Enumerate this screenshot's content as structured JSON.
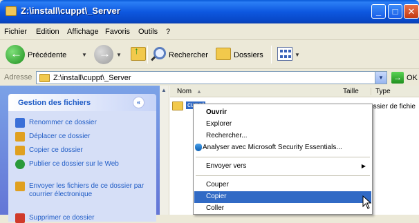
{
  "window": {
    "title": "Z:\\install\\cuppt\\_Server"
  },
  "menubar": {
    "items": [
      "Fichier",
      "Edition",
      "Affichage",
      "Favoris",
      "Outils",
      "?"
    ]
  },
  "toolbar": {
    "back_label": "Précédente",
    "search_label": "Rechercher",
    "folders_label": "Dossiers"
  },
  "address": {
    "label": "Adresse",
    "value": "Z:\\install\\cuppt\\_Server",
    "go_label": "OK"
  },
  "taskpane": {
    "header": "Gestion des fichiers",
    "collapse_glyph": "«",
    "items": [
      {
        "label": "Renommer ce dossier",
        "icon": "rename-icon",
        "color": "#3a6fd8"
      },
      {
        "label": "Déplacer ce dossier",
        "icon": "move-icon",
        "color": "#e0a020"
      },
      {
        "label": "Copier ce dossier",
        "icon": "copy-icon",
        "color": "#e0a020"
      },
      {
        "label": "Publier ce dossier sur le Web",
        "icon": "publish-web-icon",
        "color": "#2a9a3a"
      },
      {
        "label": "Envoyer les fichiers de ce dossier par courrier électronique",
        "icon": "email-icon",
        "color": "#e0a020"
      },
      {
        "label": "Supprimer ce dossier",
        "icon": "delete-icon",
        "color": "#d03a2a"
      }
    ]
  },
  "filelist": {
    "columns": {
      "name": "Nom",
      "size": "Taille",
      "type": "Type"
    },
    "rows": [
      {
        "name": "cuppt",
        "type": "Dossier de fichie"
      }
    ]
  },
  "context_menu": {
    "items": [
      {
        "label": "Ouvrir",
        "bold": true
      },
      {
        "label": "Explorer"
      },
      {
        "label": "Rechercher..."
      },
      {
        "label": "Analyser avec Microsoft Security Essentials...",
        "icon": "security-essentials-icon"
      },
      {
        "label": "Envoyer vers",
        "submenu": true
      },
      {
        "label": "Couper"
      },
      {
        "label": "Copier",
        "highlighted": true
      },
      {
        "label": "Coller"
      }
    ]
  },
  "colors": {
    "titlebar": "#0e58e0",
    "selection": "#316ac5",
    "task_link": "#215dc6",
    "taskpane_bg": "#6375d6"
  }
}
